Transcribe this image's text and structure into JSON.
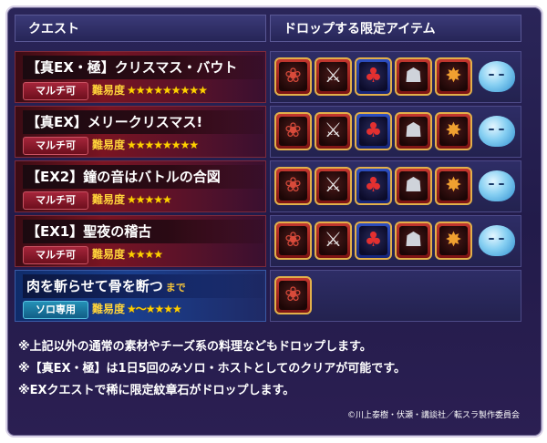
{
  "headers": {
    "quest": "クエスト",
    "drops": "ドロップする限定アイテム"
  },
  "difficulty_label": "難易度",
  "quests": [
    {
      "name": "【真EX・極】クリスマス・バウト",
      "tag": "マルチ可",
      "stars": "★★★★★★★★★",
      "star_count": 9
    },
    {
      "name": "【真EX】メリークリスマス!",
      "tag": "マルチ可",
      "stars": "★★★★★★★★",
      "star_count": 8
    },
    {
      "name": "【EX2】鐘の音はバトルの合図",
      "tag": "マルチ可",
      "stars": "★★★★★",
      "star_count": 5
    },
    {
      "name": "【EX1】聖夜の稽古",
      "tag": "マルチ可",
      "stars": "★★★★",
      "star_count": 4
    },
    {
      "name": "肉を斬らせて骨を断つ",
      "name_suffix": "まで",
      "tag": "ソロ専用",
      "stars": "★～★★★★",
      "star_range": [
        1,
        4
      ]
    }
  ],
  "item_icons": [
    "crest-dragon-icon",
    "crest-swords-icon",
    "crest-cherry-icon",
    "crest-gauntlet-icon",
    "crest-flame-icon",
    "slime-icon"
  ],
  "item_glyphs": [
    "❀",
    "⚔",
    "♣",
    "☗",
    "✸"
  ],
  "notes": [
    "※上記以外の通常の素材やチーズ系の料理などもドロップします。",
    "※【真EX・極】は1日5回のみソロ・ホストとしてのクリアが可能です。",
    "※EXクエストで稀に限定紋章石がドロップします。"
  ],
  "copyright": "©川上泰樹・伏瀬・講談社／転スラ製作委員会",
  "colors": {
    "multi_tag": "#a5253a",
    "solo_tag": "#2490b6",
    "stars": "#ffd000",
    "frame_gold": "#e2b04a"
  }
}
